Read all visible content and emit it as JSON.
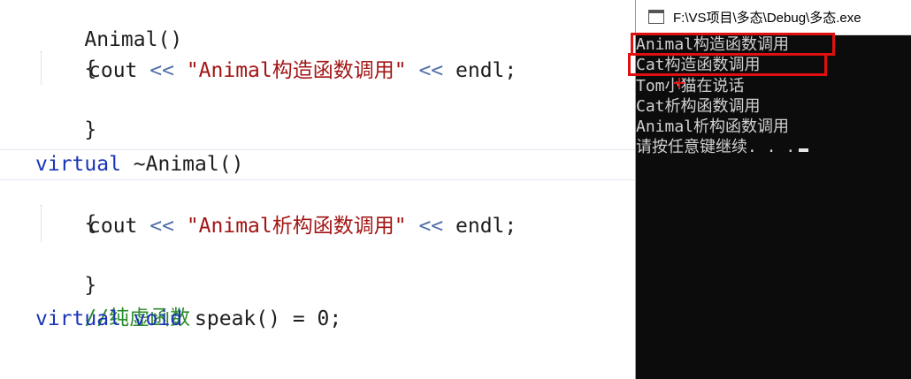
{
  "editor": {
    "ctor_signature": "Animal()",
    "brace_open": "{",
    "brace_close": "}",
    "cout": "cout",
    "op": "<<",
    "ctor_string": "\"Animal构造函数调用\"",
    "endl": "endl;",
    "dtor_virtual": "virtual",
    "dtor_name": "~Animal()",
    "dtor_string": "\"Animal析构函数调用\"",
    "comment": "//纯虚函数",
    "pv_virtual": "virtual",
    "pv_void": "void",
    "pv_rest": "speak() = 0;"
  },
  "console": {
    "title": "F:\\VS项目\\多态\\Debug\\多态.exe",
    "lines": [
      "Animal构造函数调用",
      "Cat构造函数调用",
      "Tom小猫在说话",
      "Cat析构函数调用",
      "Animal析构函数调用",
      "请按任意键继续. . ."
    ]
  },
  "colors": {
    "keyword": "#1a35b8",
    "string": "#a31515",
    "comment": "#2b8c2b",
    "highlight_box": "#e01010",
    "console_bg": "#0c0c0c"
  },
  "icons": [
    "console-app-icon",
    "mouse-cursor"
  ]
}
